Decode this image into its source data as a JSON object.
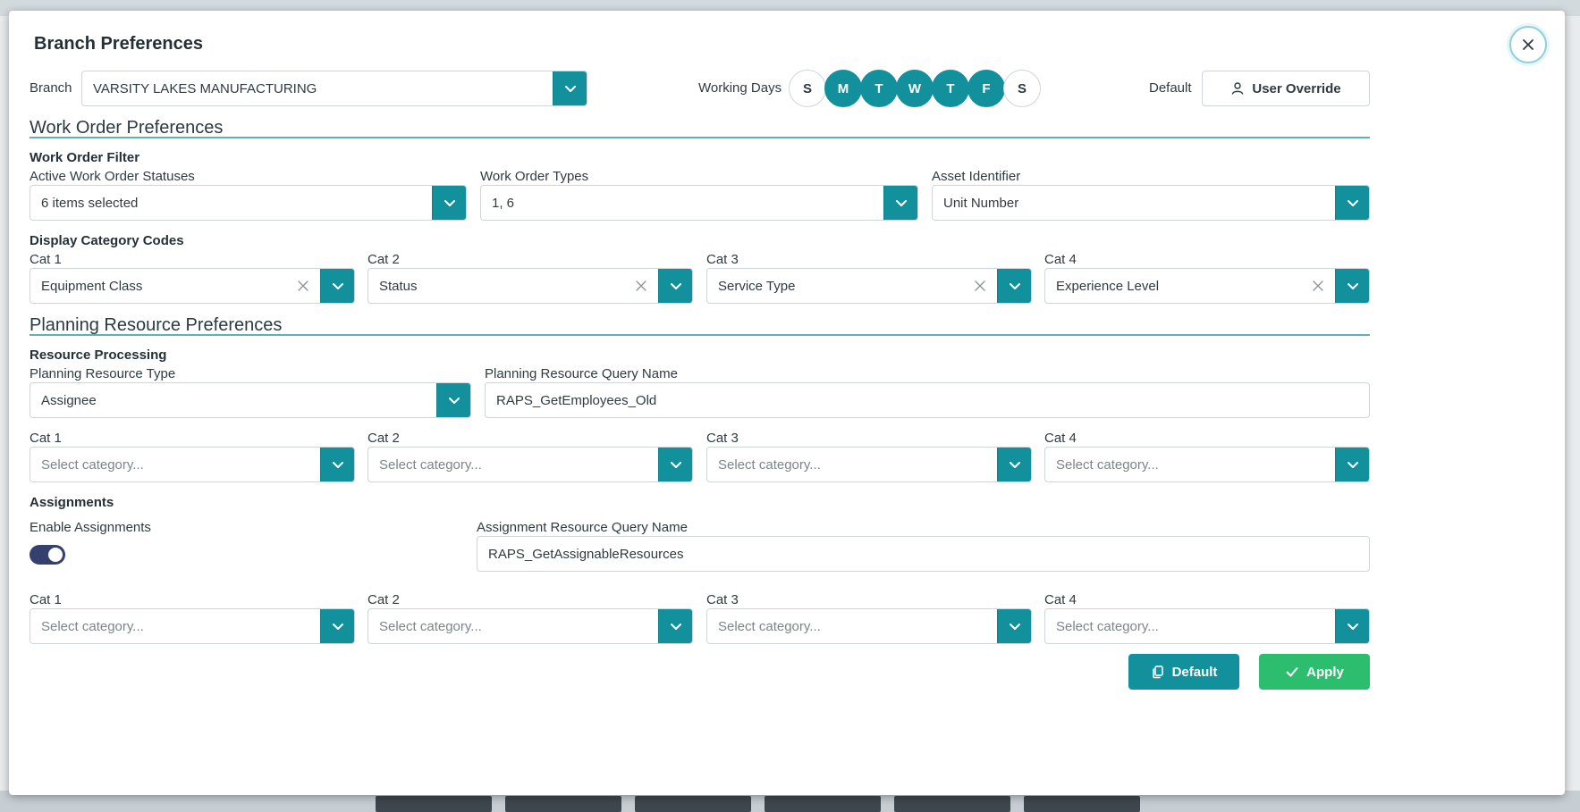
{
  "dialog": {
    "title": "Branch Preferences"
  },
  "branch": {
    "label": "Branch",
    "value": "VARSITY LAKES MANUFACTURING"
  },
  "working_days": {
    "label": "Working Days",
    "days": [
      {
        "letter": "S",
        "active": false
      },
      {
        "letter": "M",
        "active": true
      },
      {
        "letter": "T",
        "active": true
      },
      {
        "letter": "W",
        "active": true
      },
      {
        "letter": "T",
        "active": true
      },
      {
        "letter": "F",
        "active": true
      },
      {
        "letter": "S",
        "active": false
      }
    ]
  },
  "default_override": {
    "label": "Default",
    "button": "User Override"
  },
  "work_order": {
    "heading": "Work Order Preferences",
    "filter": {
      "heading": "Work Order Filter",
      "statuses": {
        "label": "Active Work Order Statuses",
        "value": "6 items selected"
      },
      "types": {
        "label": "Work Order Types",
        "value": "1, 6"
      },
      "asset": {
        "label": "Asset Identifier",
        "value": "Unit Number"
      }
    },
    "display_category": {
      "heading": "Display Category Codes",
      "cats": [
        {
          "label": "Cat 1",
          "value": "Equipment Class"
        },
        {
          "label": "Cat 2",
          "value": "Status"
        },
        {
          "label": "Cat 3",
          "value": "Service Type"
        },
        {
          "label": "Cat 4",
          "value": "Experience Level"
        }
      ]
    }
  },
  "planning": {
    "heading": "Planning Resource Preferences",
    "processing": {
      "heading": "Resource Processing",
      "type": {
        "label": "Planning Resource Type",
        "value": "Assignee"
      },
      "query": {
        "label": "Planning Resource Query Name",
        "value": "RAPS_GetEmployees_Old"
      },
      "cats": [
        {
          "label": "Cat 1",
          "placeholder": "Select category..."
        },
        {
          "label": "Cat 2",
          "placeholder": "Select category..."
        },
        {
          "label": "Cat 3",
          "placeholder": "Select category..."
        },
        {
          "label": "Cat 4",
          "placeholder": "Select category..."
        }
      ]
    },
    "assignments": {
      "heading": "Assignments",
      "enable_label": "Enable Assignments",
      "enabled": true,
      "query": {
        "label": "Assignment Resource Query Name",
        "value": "RAPS_GetAssignableResources"
      },
      "cats": [
        {
          "label": "Cat 1",
          "placeholder": "Select category..."
        },
        {
          "label": "Cat 2",
          "placeholder": "Select category..."
        },
        {
          "label": "Cat 3",
          "placeholder": "Select category..."
        },
        {
          "label": "Cat 4",
          "placeholder": "Select category..."
        }
      ]
    }
  },
  "footer": {
    "default_button": "Default",
    "apply_button": "Apply"
  },
  "colors": {
    "accent": "#12909c",
    "apply": "#2dbd6e",
    "toggle": "#34406e"
  },
  "icons": {
    "close": "close-icon",
    "chevron": "chevron-down-icon",
    "clear": "clear-x-icon",
    "user": "user-icon",
    "copy": "copy-icon",
    "check": "check-icon"
  }
}
